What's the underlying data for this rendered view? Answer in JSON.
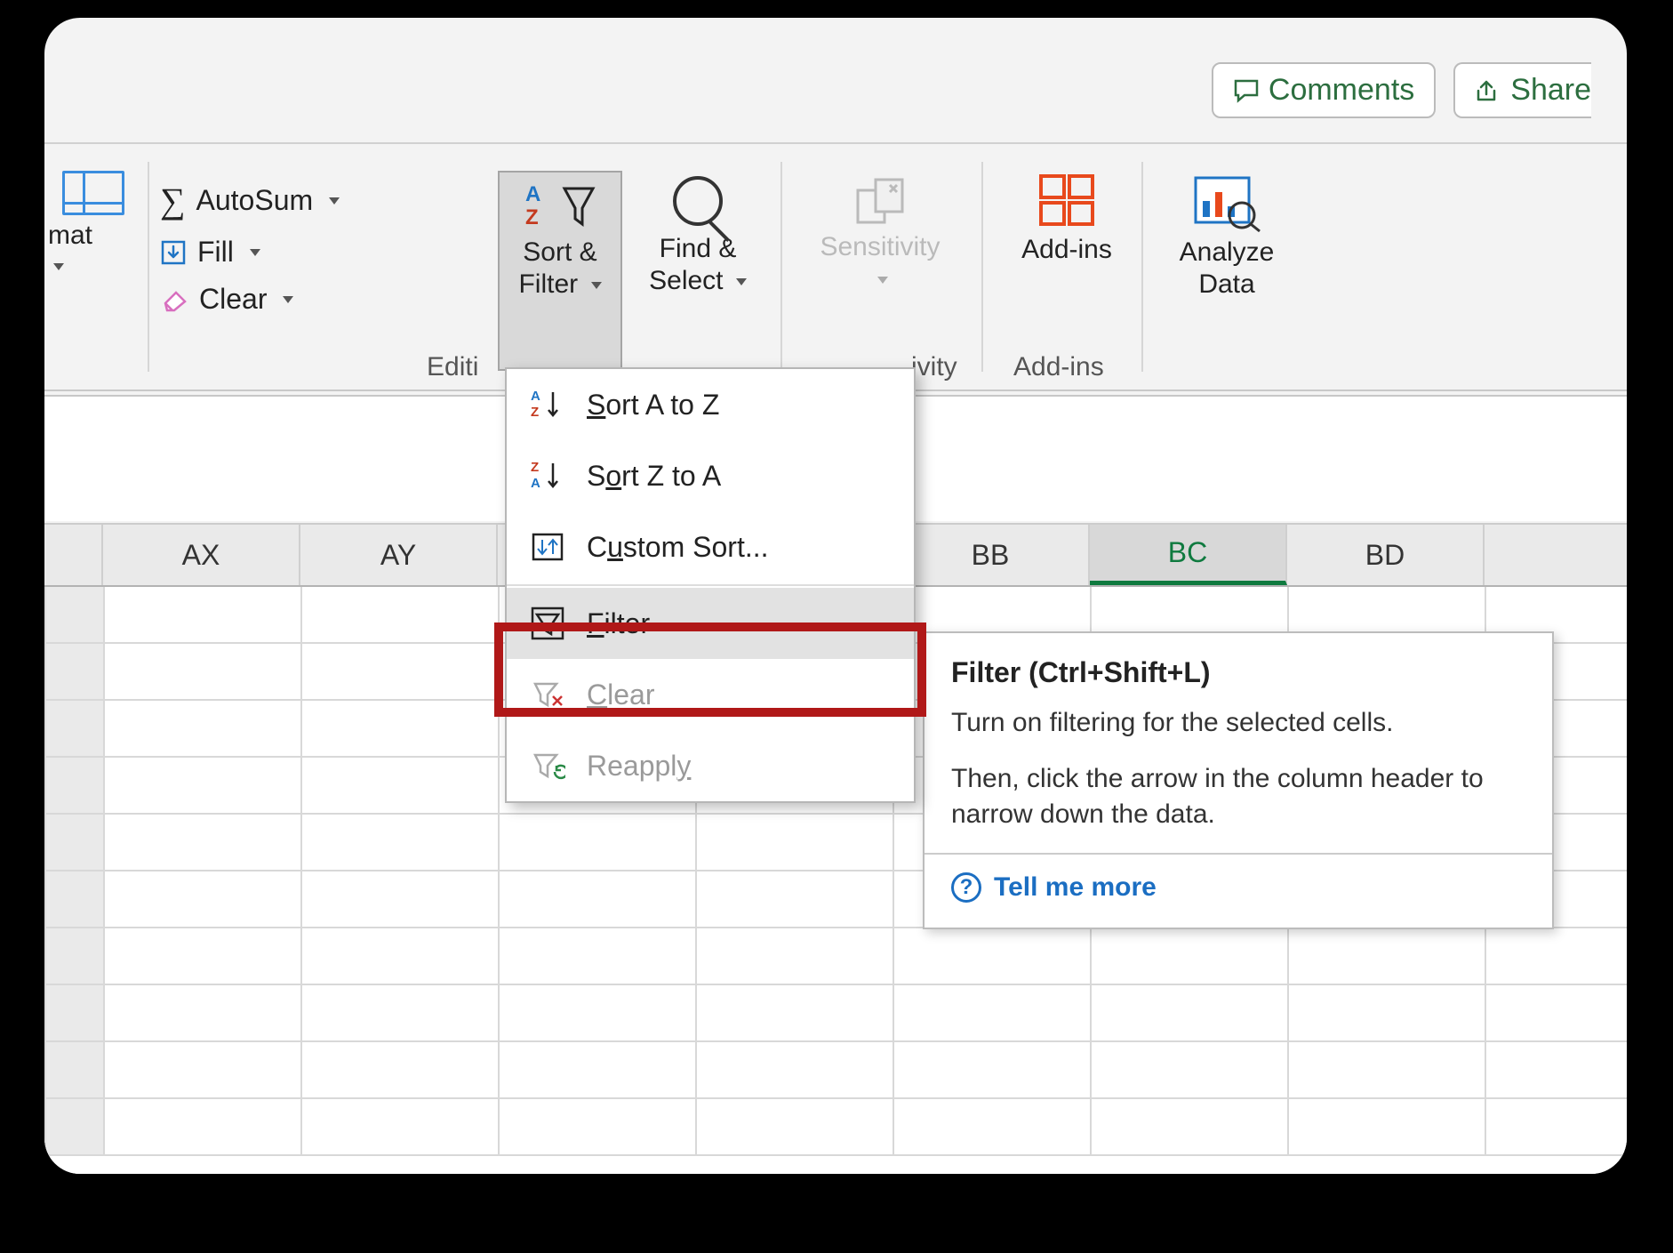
{
  "topbar": {
    "comments_label": "Comments",
    "share_label": "Share"
  },
  "ribbon": {
    "format_label": "mat",
    "autosum_label": "AutoSum",
    "fill_label": "Fill",
    "clear_label": "Clear",
    "sortfilter_line1": "Sort &",
    "sortfilter_line2": "Filter",
    "findselect_line1": "Find &",
    "findselect_line2": "Select",
    "sensitivity_label": "Sensitivity",
    "addins_label": "Add-ins",
    "analyze_line1": "Analyze",
    "analyze_line2": "Data",
    "group_editing": "Editi",
    "group_sensitivity": "ivity",
    "group_addins": "Add-ins"
  },
  "dropdown": {
    "sort_az": "Sort A to Z",
    "sort_za": "Sort Z to A",
    "custom_sort": "Custom Sort...",
    "filter": "Filter",
    "clear": "Clear",
    "reapply": "Reapply"
  },
  "tooltip": {
    "title": "Filter (Ctrl+Shift+L)",
    "body1": "Turn on filtering for the selected cells.",
    "body2": "Then, click the arrow in the column header to narrow down the data.",
    "link": "Tell me more"
  },
  "columns": [
    "AX",
    "AY",
    "",
    "",
    "BB",
    "BC",
    "BD",
    ""
  ],
  "selected_column_index": 5
}
